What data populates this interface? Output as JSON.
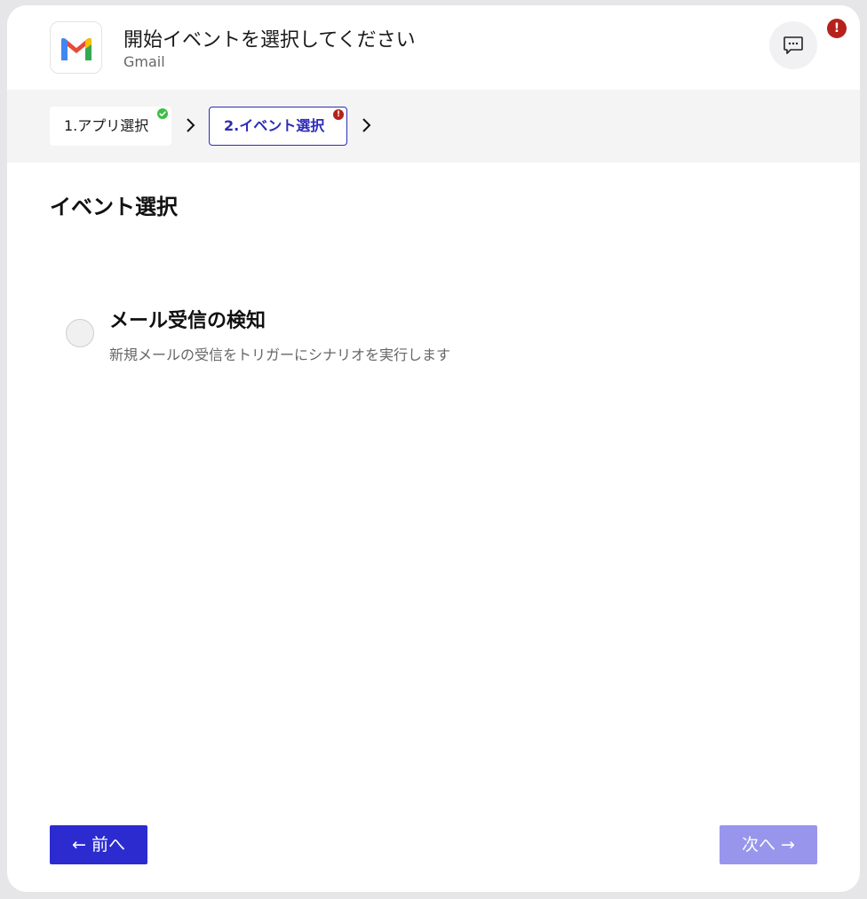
{
  "header": {
    "title": "開始イベントを選択してください",
    "subtitle": "Gmail",
    "logo_icon": "gmail-logo-icon",
    "chat_icon": "chat-bubble-icon",
    "alert_badge": "!"
  },
  "steps": [
    {
      "label": "1.アプリ選択",
      "status": "complete",
      "status_color": "#3dbe47"
    },
    {
      "label": "2.イベント選択",
      "status": "error",
      "status_glyph": "!",
      "status_color": "#b5221c"
    }
  ],
  "section": {
    "title": "イベント選択"
  },
  "options": [
    {
      "title": "メール受信の検知",
      "description": "新規メールの受信をトリガーにシナリオを実行します",
      "selected": false
    }
  ],
  "footer": {
    "prev_label": "← 前へ",
    "next_label": "次へ →"
  },
  "colors": {
    "accent": "#2c2bd0",
    "accent_disabled": "#9796ec",
    "error": "#b5221c",
    "success": "#3dbe47"
  }
}
